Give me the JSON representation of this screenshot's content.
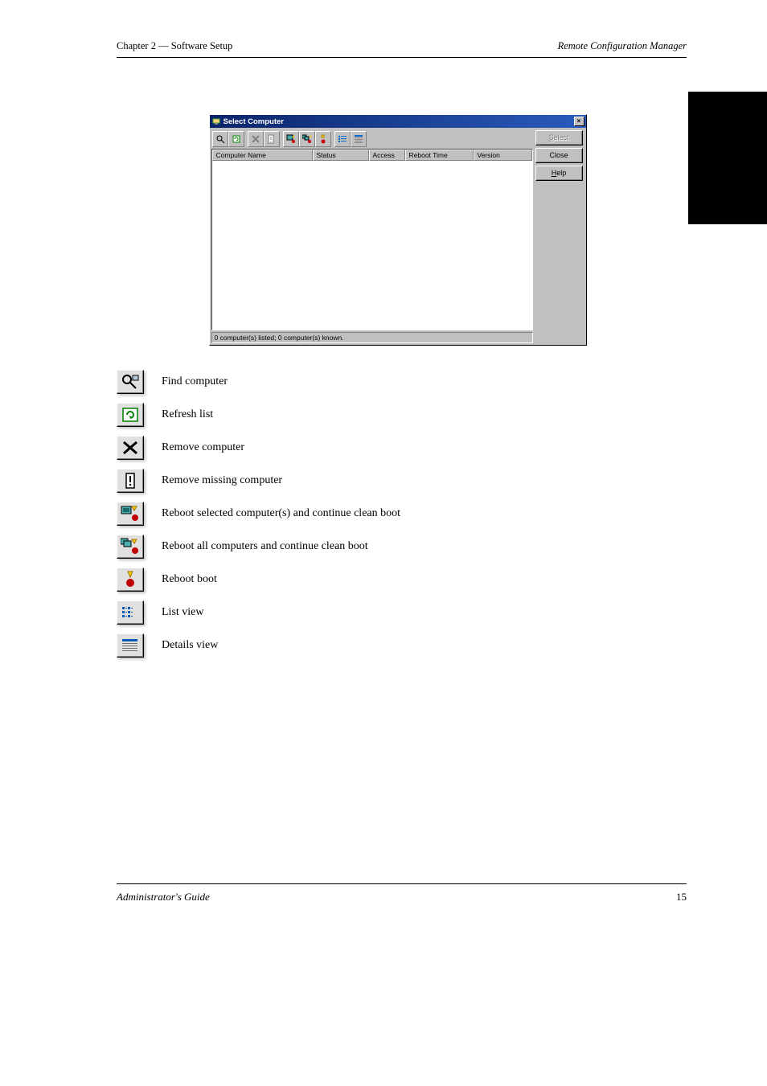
{
  "header": {
    "left": "Chapter 2 — Software Setup",
    "right": "Remote Configuration Manager"
  },
  "dialog": {
    "title": "Select Computer",
    "buttons": {
      "select_label": "Select",
      "close_label": "Close",
      "help_label": "Help"
    },
    "columns": {
      "name": "Computer Name",
      "status": "Status",
      "access": "Access",
      "reboot": "Reboot Time",
      "version": "Version"
    },
    "status": "0 computer(s) listed; 0 computer(s) known."
  },
  "legend": {
    "find": "Find computer",
    "refresh": "Refresh list",
    "remove": "Remove computer",
    "remove_missing": "Remove missing computer",
    "reboot_one": "Reboot selected computer(s) and continue clean boot",
    "reboot_all": "Reboot all computers and continue clean boot",
    "reboot_boot": "Reboot boot",
    "list": "List view",
    "details": "Details view"
  },
  "footer": {
    "left": "Administrator's Guide",
    "right": "15"
  }
}
